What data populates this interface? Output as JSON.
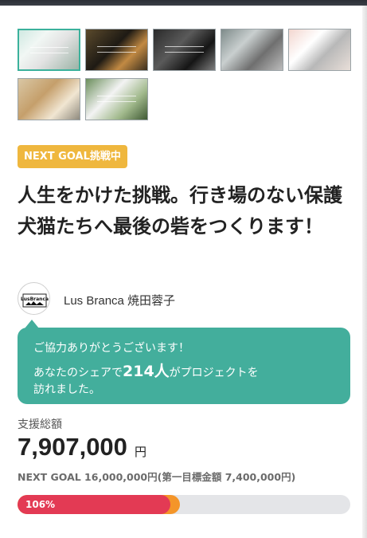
{
  "project": {
    "status_badge": "NEXT GOAL挑戦中",
    "title": "人生をかけた挑戦。行き場のない保護犬猫たちへ最後の砦をつくります！"
  },
  "owner": {
    "name": "Lus Branca 焼田蓉子",
    "avatar_logo_text": "LusBranca"
  },
  "share_message": {
    "line1": "ご協力ありがとうございます！",
    "line2_prefix": "あなたのシェアで",
    "count": "214人",
    "line2_suffix": "がプロジェクトを",
    "line3": "訪れました。"
  },
  "funding": {
    "raised_label": "支援総額",
    "raised_amount": "7,907,000",
    "currency": "円",
    "next_goal_text": "NEXT GOAL 16,000,000円(第一目標金額 7,400,000円)",
    "progress_label": "106%",
    "progress_percent": 106,
    "colors": {
      "progress_primary": "#e33a54",
      "progress_secondary": "#f49529",
      "track": "#e4e5e8",
      "accent": "#43ae9c",
      "badge": "#efb73e"
    }
  },
  "gallery": {
    "thumbnails": [
      "thumbnail-1",
      "thumbnail-2",
      "thumbnail-3",
      "thumbnail-4",
      "thumbnail-5",
      "thumbnail-6",
      "thumbnail-7"
    ],
    "selected_index": 0
  }
}
